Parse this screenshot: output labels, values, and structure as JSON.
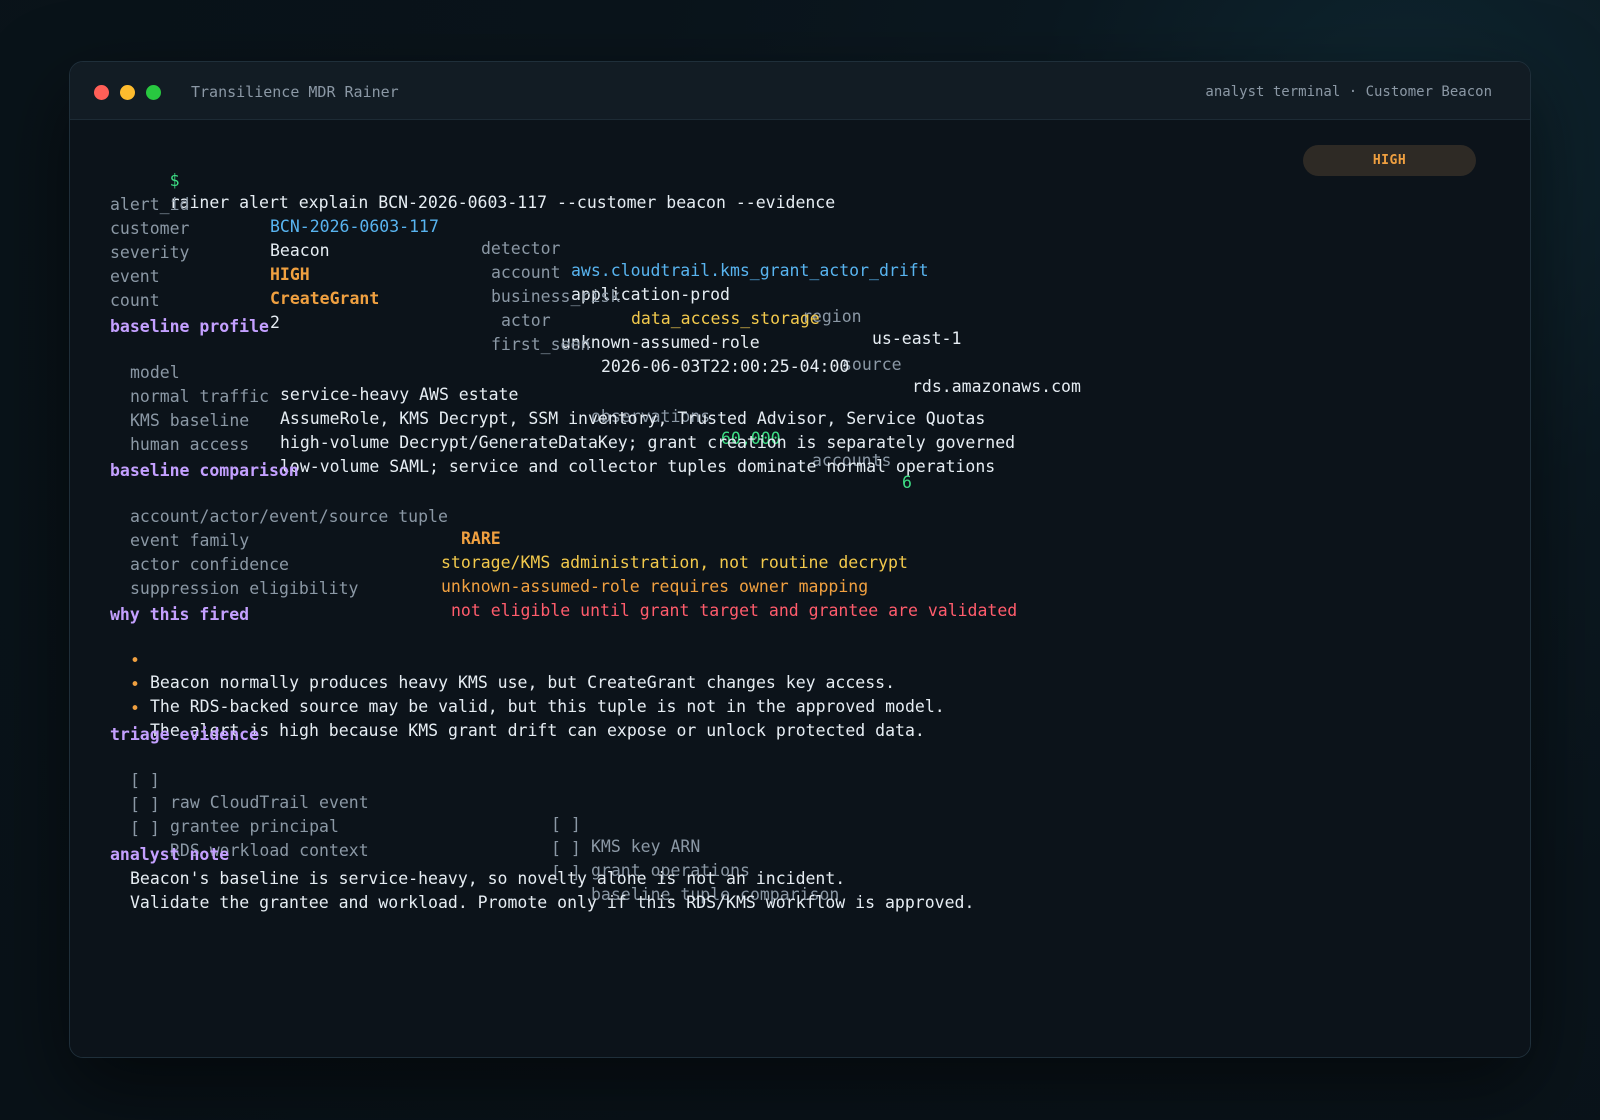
{
  "window": {
    "title": "Transilience MDR Rainer",
    "context": "analyst terminal · Customer Beacon"
  },
  "badge": "HIGH",
  "command": {
    "prompt": "$",
    "text": "rainer alert explain BCN-2026-0603-117 --customer beacon --evidence"
  },
  "alert": {
    "alert_id_label": "alert_id",
    "alert_id": "BCN-2026-0603-117",
    "detector_label": "detector",
    "detector": "aws.cloudtrail.kms_grant_actor_drift",
    "customer_label": "customer",
    "customer": "Beacon",
    "account_label": "account",
    "account": "application-prod",
    "region_label": "region",
    "region": "us-east-1",
    "severity_label": "severity",
    "severity": "HIGH",
    "business_risk_label": "business_risk",
    "business_risk": "data_access_storage",
    "event_label": "event",
    "event": "CreateGrant",
    "actor_label": "actor",
    "actor": "unknown-assumed-role",
    "source_label": "source",
    "source": "rds.amazonaws.com",
    "count_label": "count",
    "count": "2",
    "first_seen_label": "first_seen",
    "first_seen": "2026-06-03T22:00:25-04:00"
  },
  "baseline_profile": {
    "heading": "baseline profile",
    "model_label": "model",
    "model": "service-heavy AWS estate",
    "observations_label": "observations",
    "observations": "60,000",
    "accounts_label": "accounts",
    "accounts": "6",
    "normal_traffic_label": "normal traffic",
    "normal_traffic": "AssumeRole, KMS Decrypt, SSM inventory, Trusted Advisor, Service Quotas",
    "kms_baseline_label": "KMS baseline",
    "kms_baseline": "high-volume Decrypt/GenerateDataKey; grant creation is separately governed",
    "human_access_label": "human access",
    "human_access": "low-volume SAML; service and collector tuples dominate normal operations"
  },
  "baseline_comparison": {
    "heading": "baseline comparison",
    "tuple_label": "account/actor/event/source tuple",
    "tuple": "RARE",
    "event_family_label": "event family",
    "event_family": "storage/KMS administration, not routine decrypt",
    "actor_confidence_label": "actor confidence",
    "actor_confidence": "unknown-assumed-role requires owner mapping",
    "suppression_label": "suppression eligibility",
    "suppression": "not eligible until grant target and grantee are validated"
  },
  "why_fired": {
    "heading": "why this fired",
    "bullet": "•",
    "items": [
      "Beacon normally produces heavy KMS use, but CreateGrant changes key access.",
      "The RDS-backed source may be valid, but this tuple is not in the approved model.",
      "The alert is high because KMS grant drift can expose or unlock protected data."
    ]
  },
  "triage": {
    "heading": "triage evidence",
    "checkbox": "[ ]",
    "items": [
      "raw CloudTrail event",
      "KMS key ARN",
      "grantee principal",
      "grant operations",
      "RDS workload context",
      "baseline tuple comparison"
    ]
  },
  "analyst_note": {
    "heading": "analyst note",
    "lines": [
      "Beacon's baseline is service-heavy, so novelty alone is not an incident.",
      "Validate the grantee and workload. Promote only if this RDS/KMS workflow is approved."
    ]
  }
}
